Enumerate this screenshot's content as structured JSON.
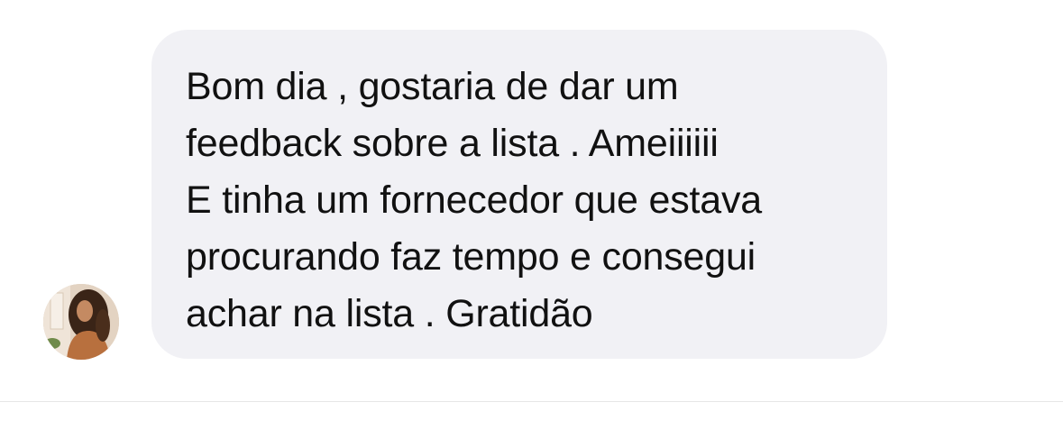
{
  "message": {
    "sender_avatar": {
      "icon": "user-avatar-photo"
    },
    "bubble": {
      "background": "#f1f1f5",
      "text_color": "#111111",
      "lines": [
        "Bom dia , gostaria de dar um",
        "feedback sobre a lista . Ameiiiiii",
        "E tinha um fornecedor que estava",
        "procurando faz tempo e consegui",
        "achar na lista . Gratidão"
      ]
    }
  }
}
